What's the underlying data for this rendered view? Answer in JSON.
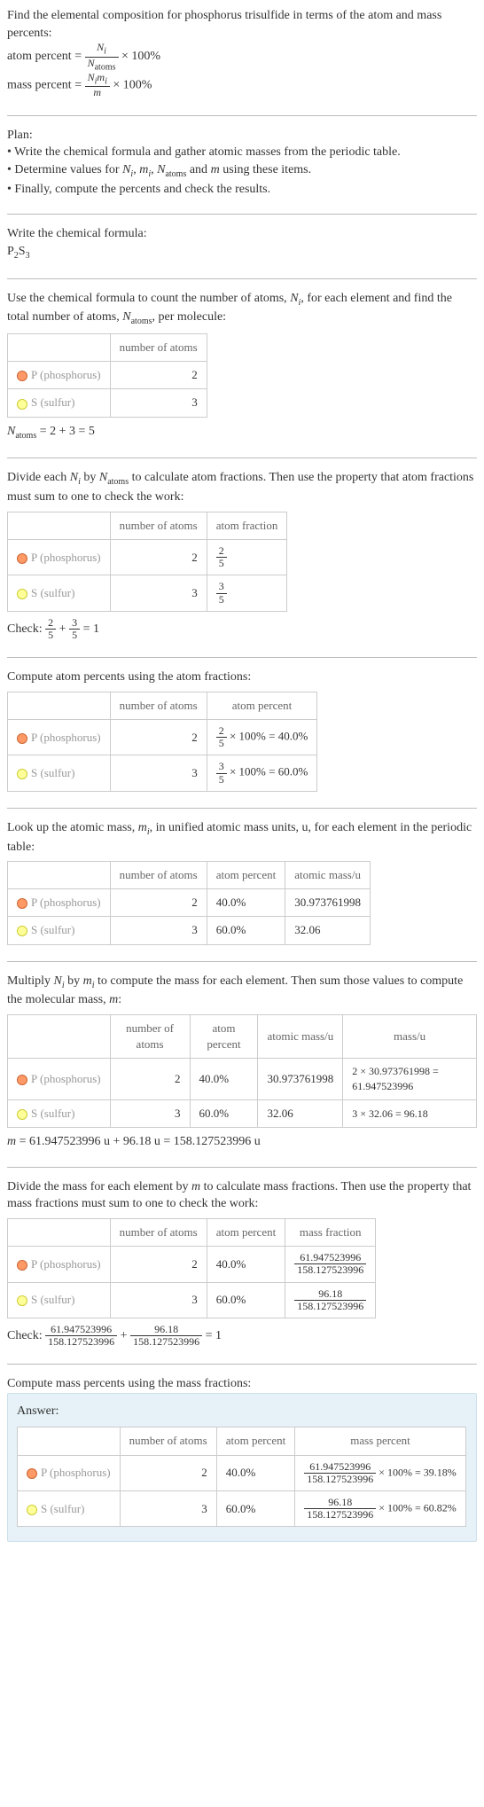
{
  "intro": {
    "line1": "Find the elemental composition for phosphorus trisulfide in terms of the atom and mass percents:",
    "atom_percent_label": "atom percent",
    "mass_percent_label": "mass percent",
    "times100": "× 100%"
  },
  "plan": {
    "heading": "Plan:",
    "b1": "• Write the chemical formula and gather atomic masses from the periodic table.",
    "b2_pre": "• Determine values for ",
    "b2_post": " using these items.",
    "b3": "• Finally, compute the percents and check the results."
  },
  "formula_sec": {
    "heading": "Write the chemical formula:",
    "formula_base1": "P",
    "formula_sub1": "2",
    "formula_base2": "S",
    "formula_sub2": "3"
  },
  "count_sec": {
    "text_pre": "Use the chemical formula to count the number of atoms, ",
    "text_mid": ", for each element and find the total number of atoms, ",
    "text_post": ", per molecule:",
    "eq": " = 2 + 3 = 5"
  },
  "headers": {
    "number_of_atoms": "number of atoms",
    "atom_fraction": "atom fraction",
    "atom_percent": "atom percent",
    "atomic_mass": "atomic mass/u",
    "mass": "mass/u",
    "mass_fraction": "mass fraction",
    "mass_percent": "mass percent"
  },
  "elements": {
    "p": {
      "label": "P (phosphorus)",
      "atoms": "2"
    },
    "s": {
      "label": "S (sulfur)",
      "atoms": "3"
    }
  },
  "fractions_sec": {
    "text_pre": "Divide each ",
    "text_mid": " by ",
    "text_post": " to calculate atom fractions. Then use the property that atom fractions must sum to one to check the work:",
    "p_num": "2",
    "p_den": "5",
    "s_num": "3",
    "s_den": "5",
    "check_pre": "Check: ",
    "check_plus": " + ",
    "check_eq": " = 1"
  },
  "atom_pct_sec": {
    "text": "Compute atom percents using the atom fractions:",
    "p_num": "2",
    "p_den": "5",
    "p_res": " × 100% = 40.0%",
    "s_num": "3",
    "s_den": "5",
    "s_res": " × 100% = 60.0%"
  },
  "atomic_mass_sec": {
    "text_pre": "Look up the atomic mass, ",
    "text_post": ", in unified atomic mass units, u, for each element in the periodic table:",
    "p_pct": "40.0%",
    "p_mass": "30.973761998",
    "s_pct": "60.0%",
    "s_mass": "32.06"
  },
  "mass_calc_sec": {
    "text_pre": "Multiply ",
    "text_mid": " by ",
    "text_post": " to compute the mass for each element. Then sum those values to compute the molecular mass, ",
    "text_end": ":",
    "p_massu": "2 × 30.973761998 = 61.947523996",
    "s_massu": "3 × 32.06 = 96.18",
    "m_eq_pre": " = 61.947523996 u + 96.18 u = 158.127523996 u"
  },
  "mass_frac_sec": {
    "text_pre": "Divide the mass for each element by ",
    "text_post": " to calculate mass fractions. Then use the property that mass fractions must sum to one to check the work:",
    "p_num": "61.947523996",
    "den": "158.127523996",
    "s_num": "96.18",
    "check_pre": "Check: ",
    "check_plus": " + ",
    "check_eq": " = 1"
  },
  "final_sec": {
    "text": "Compute mass percents using the mass fractions:",
    "answer": "Answer:",
    "p_num": "61.947523996",
    "den": "158.127523996",
    "p_res": "× 100% = 39.18%",
    "s_num": "96.18",
    "s_res": "× 100% = 60.82%"
  },
  "sym": {
    "Ni": "N",
    "i": "i",
    "Natoms": "N",
    "atoms": "atoms",
    "mi": "m",
    "m": "m",
    "and": " and "
  },
  "chart_data": {
    "type": "table",
    "elements": [
      {
        "name": "P (phosphorus)",
        "atoms": 2,
        "atom_fraction": "2/5",
        "atom_percent": 40.0,
        "atomic_mass_u": 30.973761998,
        "mass_u": 61.947523996,
        "mass_fraction": "61.947523996/158.127523996",
        "mass_percent": 39.18
      },
      {
        "name": "S (sulfur)",
        "atoms": 3,
        "atom_fraction": "3/5",
        "atom_percent": 60.0,
        "atomic_mass_u": 32.06,
        "mass_u": 96.18,
        "mass_fraction": "96.18/158.127523996",
        "mass_percent": 60.82
      }
    ],
    "N_atoms": 5,
    "molecular_mass_u": 158.127523996
  }
}
